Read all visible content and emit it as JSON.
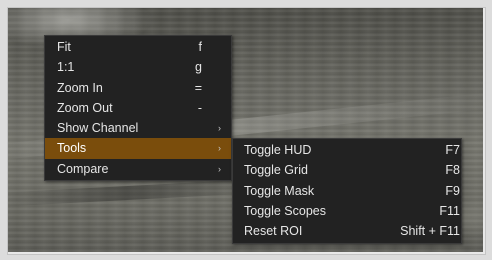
{
  "context_menu": {
    "items": [
      {
        "label": "Fit",
        "shortcut": "f"
      },
      {
        "label": "1:1",
        "shortcut": "g"
      },
      {
        "label": "Zoom In",
        "shortcut": "="
      },
      {
        "label": "Zoom Out",
        "shortcut": "-"
      },
      {
        "label": "Show Channel",
        "submenu_arrow": "›"
      },
      {
        "label": "Tools",
        "submenu_arrow": "›",
        "highlighted": true
      },
      {
        "label": "Compare",
        "submenu_arrow": "›"
      }
    ]
  },
  "tools_submenu": {
    "items": [
      {
        "label": "Toggle HUD",
        "shortcut": "F7"
      },
      {
        "label": "Toggle Grid",
        "shortcut": "F8"
      },
      {
        "label": "Toggle Mask",
        "shortcut": "F9"
      },
      {
        "label": "Toggle Scopes",
        "shortcut": "F11"
      },
      {
        "label": "Reset ROI",
        "shortcut": "Shift + F11"
      }
    ]
  },
  "colors": {
    "menu_background": "#222222",
    "highlight": "#7a4d0c",
    "text": "#e6e6e6"
  }
}
